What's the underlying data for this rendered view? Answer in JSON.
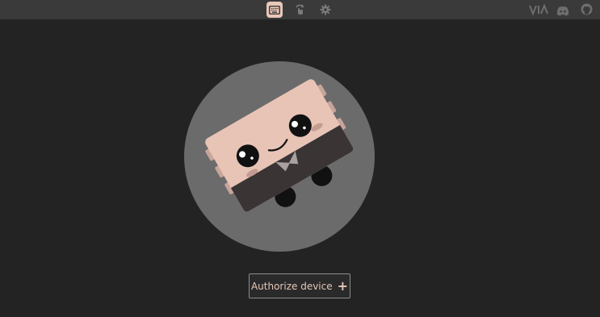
{
  "topbar": {
    "nav_icons": [
      {
        "name": "keyboard-icon",
        "active": true
      },
      {
        "name": "rotate-hand-icon",
        "active": false
      },
      {
        "name": "gear-icon",
        "active": false
      }
    ],
    "right_icons": [
      {
        "name": "via-logo-icon",
        "label": "VIA"
      },
      {
        "name": "discord-icon"
      },
      {
        "name": "github-icon"
      }
    ]
  },
  "main": {
    "authorize_button": {
      "label": "Authorize device",
      "icon": "plus-icon"
    }
  },
  "colors": {
    "background": "#232323",
    "topbar": "#3a3a3a",
    "accent": "#e9c8b9",
    "circle": "#6b6b6b"
  }
}
